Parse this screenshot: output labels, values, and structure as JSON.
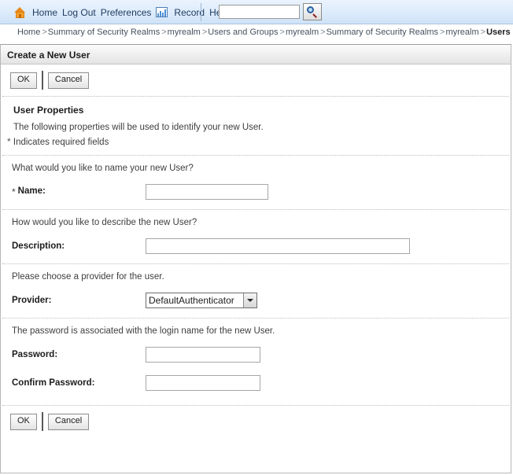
{
  "topbar": {
    "home_label": "Home",
    "logout_label": "Log Out",
    "preferences_label": "Preferences",
    "record_label": "Record",
    "help_label": "Help",
    "search_value": "",
    "search_placeholder": "",
    "home_icon": "home-icon",
    "record_icon": "chart-icon",
    "search_icon": "magnifier-icon",
    "accent_color": "#dcebfb"
  },
  "breadcrumb": {
    "separator": ">",
    "items": [
      {
        "label": "Home",
        "current": false
      },
      {
        "label": "Summary of Security Realms",
        "current": false
      },
      {
        "label": "myrealm",
        "current": false
      },
      {
        "label": "Users and Groups",
        "current": false
      },
      {
        "label": "myrealm",
        "current": false
      },
      {
        "label": "Summary of Security Realms",
        "current": false
      },
      {
        "label": "myrealm",
        "current": false
      },
      {
        "label": "Users and Groups",
        "current": true
      }
    ]
  },
  "panel": {
    "title": "Create a New User",
    "ok_label": "OK",
    "cancel_label": "Cancel",
    "section_heading": "User Properties",
    "section_description": "The following properties will be used to identify your new User.",
    "required_note_star": "*",
    "required_note_text": "Indicates required fields",
    "groups": [
      {
        "prompt": "What would you like to name your new User?",
        "field": {
          "required_star": "*",
          "label": "Name:",
          "type": "text",
          "value": "",
          "placeholder": ""
        }
      },
      {
        "prompt": "How would you like to describe the new User?",
        "field": {
          "required_star": "",
          "label": "Description:",
          "type": "text",
          "value": "",
          "placeholder": ""
        }
      },
      {
        "prompt": "Please choose a provider for the user.",
        "field": {
          "required_star": "",
          "label": "Provider:",
          "type": "select",
          "value": "DefaultAuthenticator",
          "options": [
            "DefaultAuthenticator"
          ]
        }
      },
      {
        "prompt": "The password is associated with the login name for the new User.",
        "field": {
          "required_star": "",
          "label": "Password:",
          "type": "password",
          "value": "",
          "placeholder": ""
        },
        "field2": {
          "required_star": "",
          "label": "Confirm Password:",
          "type": "password",
          "value": "",
          "placeholder": ""
        }
      }
    ]
  }
}
